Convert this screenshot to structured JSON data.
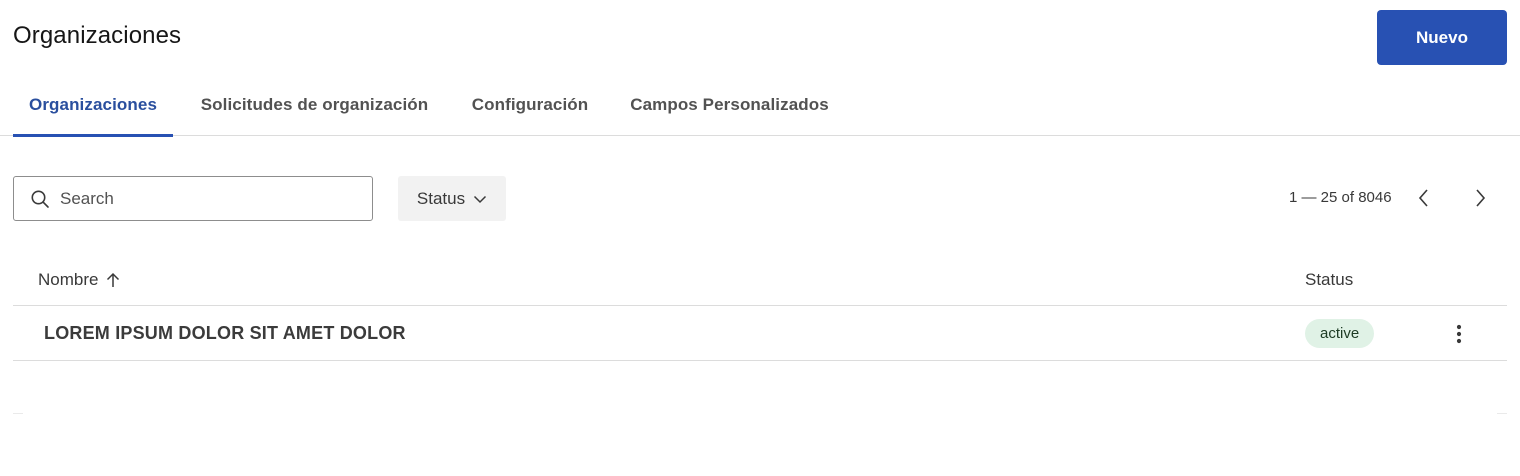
{
  "header": {
    "title": "Organizaciones",
    "new_button_label": "Nuevo"
  },
  "tabs": [
    {
      "label": "Organizaciones",
      "active": true
    },
    {
      "label": "Solicitudes de organización",
      "active": false
    },
    {
      "label": "Configuración",
      "active": false
    },
    {
      "label": "Campos Personalizados",
      "active": false
    }
  ],
  "toolbar": {
    "search_placeholder": "Search",
    "search_value": "",
    "status_filter_label": "Status",
    "pagination_text": "1 — 25 of 8046"
  },
  "table": {
    "columns": [
      {
        "label": "Nombre",
        "sort": "ascending"
      },
      {
        "label": "Status"
      }
    ],
    "rows": [
      {
        "name": "LOREM IPSUM DOLOR SIT AMET DOLOR",
        "status": "active"
      }
    ]
  },
  "colors": {
    "primary": "#2851b3",
    "active_tab_text": "#2a4f9e",
    "badge_bg": "#e0f2e6"
  },
  "icons": [
    "search-icon",
    "chevron-down-icon",
    "chevron-left-icon",
    "chevron-right-icon",
    "arrow-up-icon",
    "kebab-menu-icon"
  ]
}
